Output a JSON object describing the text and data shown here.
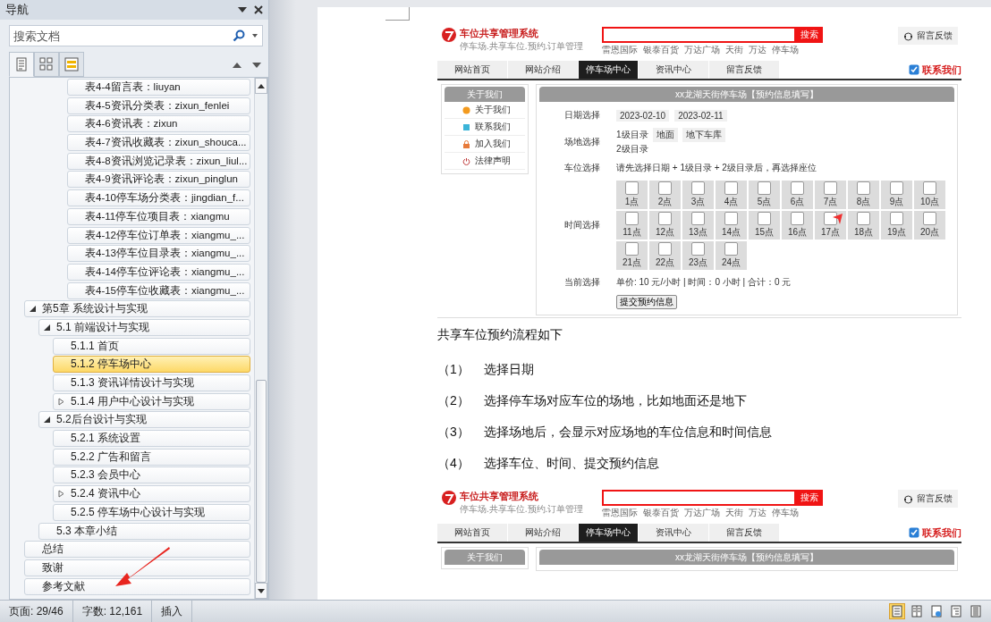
{
  "nav_pane": {
    "title": "导航",
    "search": {
      "placeholder": "搜索文档"
    },
    "view_tabs": [
      {
        "kind": "headings",
        "selected": true
      },
      {
        "kind": "pages",
        "selected": false
      },
      {
        "kind": "results",
        "selected": false
      }
    ],
    "outline": {
      "partial_branch": [
        {
          "label": "表4-4留言表：liuyan",
          "selected": false
        },
        {
          "label": "表4-5资讯分类表：zixun_fenlei",
          "selected": false
        },
        {
          "label": "表4-6资讯表：zixun",
          "selected": false
        },
        {
          "label": "表4-7资讯收藏表：zixun_shouca...",
          "selected": false
        },
        {
          "label": "表4-8资讯浏览记录表：zixun_liul...",
          "selected": false
        },
        {
          "label": "表4-9资讯评论表：zixun_pinglun",
          "selected": false
        },
        {
          "label": "表4-10停车场分类表：jingdian_f...",
          "selected": false
        },
        {
          "label": "表4-11停车位项目表：xiangmu",
          "selected": false
        },
        {
          "label": "表4-12停车位订单表：xiangmu_...",
          "selected": false
        },
        {
          "label": "表4-13停车位目录表：xiangmu_...",
          "selected": false
        },
        {
          "label": "表4-14停车位评论表：xiangmu_...",
          "selected": false
        },
        {
          "label": "表4-15停车位收藏表：xiangmu_...",
          "selected": false
        }
      ],
      "items": [
        {
          "label": "第5章 系统设计与实现",
          "selected": false,
          "expanded": true,
          "children": [
            {
              "label": "5.1 前端设计与实现",
              "selected": false,
              "expanded": true,
              "children": [
                {
                  "label": "5.1.1 首页",
                  "selected": false
                },
                {
                  "label": "5.1.2 停车场中心",
                  "selected": true
                },
                {
                  "label": "5.1.3 资讯详情设计与实现",
                  "selected": false
                },
                {
                  "label": "5.1.4 用户中心设计与实现",
                  "selected": false,
                  "expanded": false
                }
              ]
            },
            {
              "label": "5.2后台设计与实现",
              "selected": false,
              "expanded": true,
              "children": [
                {
                  "label": "5.2.1 系统设置",
                  "selected": false
                },
                {
                  "label": "5.2.2 广告和留言",
                  "selected": false
                },
                {
                  "label": "5.2.3 会员中心",
                  "selected": false
                },
                {
                  "label": "5.2.4 资讯中心",
                  "selected": false,
                  "expanded": false
                },
                {
                  "label": "5.2.5 停车场中心设计与实现",
                  "selected": false
                }
              ]
            },
            {
              "label": "5.3 本章小结",
              "selected": false
            }
          ]
        },
        {
          "label": "总结",
          "selected": false
        },
        {
          "label": "致谢",
          "selected": false
        },
        {
          "label": "参考文献",
          "selected": false
        }
      ]
    }
  },
  "document": {
    "screenshot_top": {
      "logo_title": "车位共享管理系统",
      "logo_subtitle": "停车场.共享车位.预约.订单管理",
      "search_button": "搜索",
      "search_hints": [
        "雷恩国际",
        "银泰百货",
        "万达广场",
        "天街",
        "万达",
        "停车场"
      ],
      "feedback_button": "留言反馈",
      "nav_tabs": [
        {
          "label": "网站首页",
          "selected": false
        },
        {
          "label": "网站介绍",
          "selected": false
        },
        {
          "label": "停车场中心",
          "selected": true
        },
        {
          "label": "资讯中心",
          "selected": false
        },
        {
          "label": "留言反馈",
          "selected": false
        }
      ],
      "contact": "联系我们",
      "sidebar": {
        "title": "关于我们",
        "items": [
          {
            "label": "关于我们",
            "kind": "info"
          },
          {
            "label": "联系我们",
            "kind": "contact"
          },
          {
            "label": "加入我们",
            "kind": "join"
          },
          {
            "label": "法律声明",
            "kind": "legal"
          }
        ]
      },
      "panel_title": "xx龙湖天街停车场【预约信息填写】",
      "form": {
        "date_label": "日期选择",
        "dates": [
          "2023-02-10",
          "2023-02-11"
        ],
        "site_label": "场地选择",
        "level1_label": "1级目录",
        "level1_options": [
          "地面",
          "地下车库"
        ],
        "level2_label": "2级目录",
        "seat_label": "车位选择",
        "seat_hint": "请先选择日期 + 1级目录 + 2级目录后，再选择座位",
        "time_label": "时间选择",
        "slots": [
          {
            "label": "1点",
            "checked": false,
            "hovered": false
          },
          {
            "label": "2点",
            "checked": false,
            "hovered": false
          },
          {
            "label": "3点",
            "checked": false,
            "hovered": false
          },
          {
            "label": "4点",
            "checked": false,
            "hovered": false
          },
          {
            "label": "5点",
            "checked": false,
            "hovered": false
          },
          {
            "label": "6点",
            "checked": false,
            "hovered": false
          },
          {
            "label": "7点",
            "checked": false,
            "hovered": false
          },
          {
            "label": "8点",
            "checked": false,
            "hovered": false
          },
          {
            "label": "9点",
            "checked": false,
            "hovered": false
          },
          {
            "label": "10点",
            "checked": false,
            "hovered": false
          },
          {
            "label": "11点",
            "checked": false,
            "hovered": false
          },
          {
            "label": "12点",
            "checked": false,
            "hovered": false
          },
          {
            "label": "13点",
            "checked": false,
            "hovered": false
          },
          {
            "label": "14点",
            "checked": false,
            "hovered": false
          },
          {
            "label": "15点",
            "checked": false,
            "hovered": false
          },
          {
            "label": "16点",
            "checked": false,
            "hovered": false
          },
          {
            "label": "17点",
            "checked": false,
            "hovered": true
          },
          {
            "label": "18点",
            "checked": false,
            "hovered": false
          },
          {
            "label": "19点",
            "checked": false,
            "hovered": false
          },
          {
            "label": "20点",
            "checked": false,
            "hovered": false
          },
          {
            "label": "21点",
            "checked": false,
            "hovered": false
          },
          {
            "label": "22点",
            "checked": false,
            "hovered": false
          },
          {
            "label": "23点",
            "checked": false,
            "hovered": false
          },
          {
            "label": "24点",
            "checked": false,
            "hovered": false
          }
        ],
        "current_label": "当前选择",
        "current_value": "单价: 10 元/小时 | 时间：0 小时 | 合计：0 元",
        "submit": "提交预约信息"
      }
    },
    "intro": "共享车位预约流程如下",
    "steps": [
      {
        "number": "（1）",
        "text": "选择日期"
      },
      {
        "number": "（2）",
        "text": "选择停车场对应车位的场地，比如地面还是地下"
      },
      {
        "number": "（3）",
        "text": "选择场地后，会显示对应场地的车位信息和时间信息"
      },
      {
        "number": "（4）",
        "text": "选择车位、时间、提交预约信息"
      }
    ],
    "screenshot_bottom": {
      "logo_title": "车位共享管理系统",
      "logo_subtitle": "停车场.共享车位.预约.订单管理",
      "search_button": "搜索",
      "search_hints": [
        "雷恩国际",
        "银泰百货",
        "万达广场",
        "天街",
        "万达",
        "停车场"
      ],
      "feedback_button": "留言反馈",
      "nav_tabs": [
        {
          "label": "网站首页",
          "selected": false
        },
        {
          "label": "网站介绍",
          "selected": false
        },
        {
          "label": "停车场中心",
          "selected": true
        },
        {
          "label": "资讯中心",
          "selected": false
        },
        {
          "label": "留言反馈",
          "selected": false
        }
      ],
      "contact": "联系我们",
      "sidebar": {
        "title": "关于我们"
      },
      "panel_title": "xx龙湖天街停车场【预约信息填写】"
    }
  },
  "status_bar": {
    "page": "页面: 29/46",
    "words": "字数: 12,161",
    "mode": "插入",
    "views": [
      {
        "kind": "print",
        "selected": true
      },
      {
        "kind": "reading",
        "selected": false
      },
      {
        "kind": "web",
        "selected": false
      },
      {
        "kind": "outline",
        "selected": false
      },
      {
        "kind": "draft",
        "selected": false
      }
    ]
  }
}
